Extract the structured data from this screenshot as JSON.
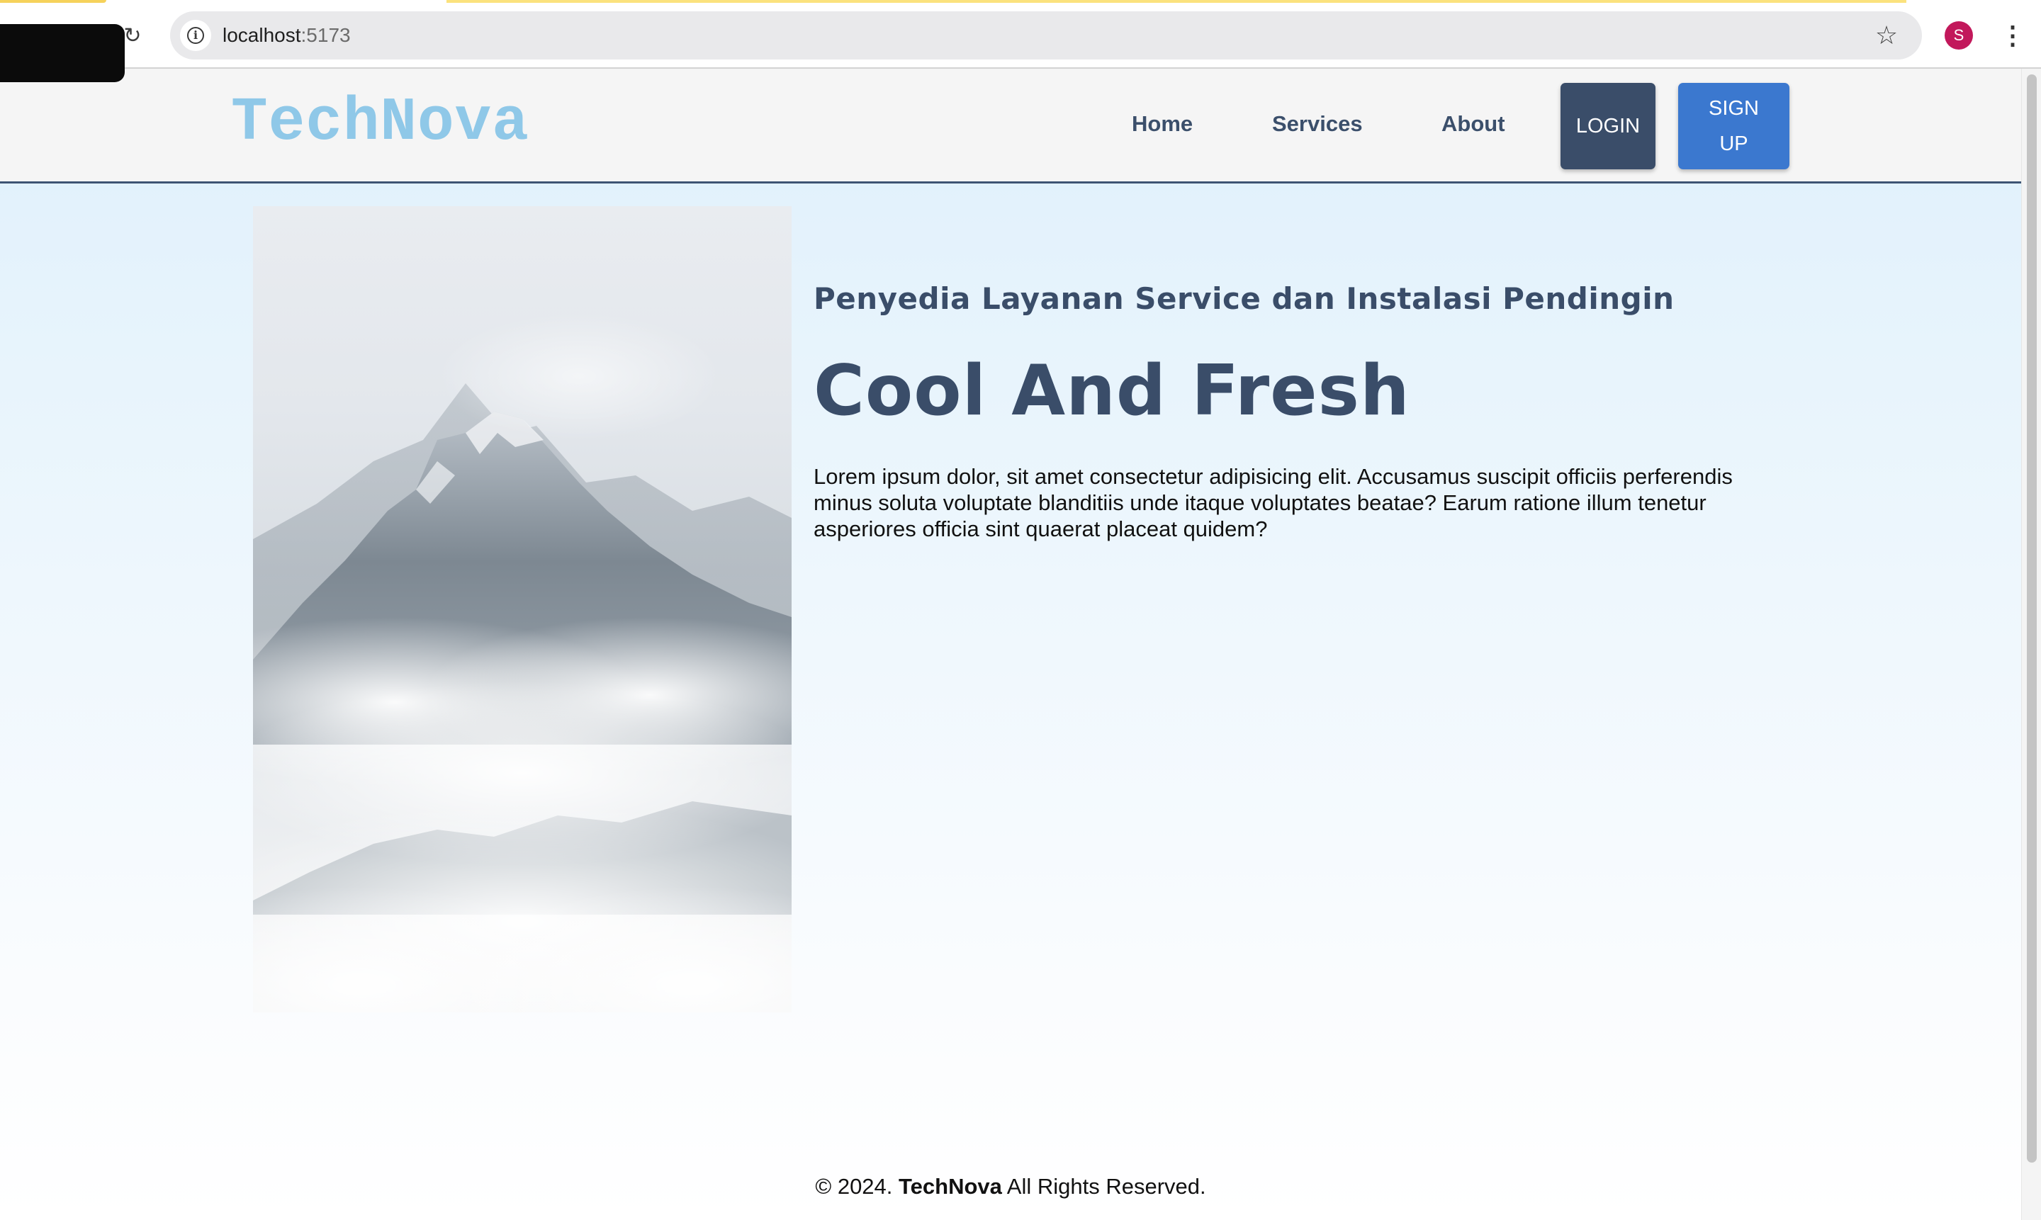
{
  "browser": {
    "url_host": "localhost",
    "url_port": ":5173",
    "profile_initial": "S"
  },
  "navbar": {
    "logo": "TechNova",
    "links": [
      "Home",
      "Services",
      "About"
    ],
    "login_label": "LOGIN",
    "signup_line1": "SIGN",
    "signup_line2": "UP"
  },
  "hero": {
    "image_alt": "snowy mountain peak above clouds",
    "tagline": "Penyedia Layanan Service dan Instalasi Pendingin",
    "headline": "Cool And Fresh",
    "body": "Lorem ipsum dolor, sit amet consectetur adipisicing elit. Accusamus suscipit officiis perferendis minus soluta voluptate blanditiis unde itaque voluptates beatae? Earum ratione illum tenetur asperiores officia sint quaerat placeat quidem?"
  },
  "footer": {
    "prefix": "© 2024. ",
    "brand": "TechNova",
    "suffix": " All Rights Reserved."
  },
  "colors": {
    "logo": "#8fc8e8",
    "navy": "#3a4d69",
    "signup_blue": "#3b78cf"
  }
}
